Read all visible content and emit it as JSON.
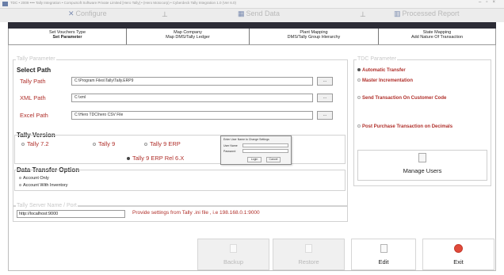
{
  "window": {
    "title": "TDC • 2009 •••• Tally Integration • CompuSoft Software Private Limited [Hero Tally] • (Hero Motocorp) • Cyberdeck Tally Integration 1.0 (Ver 6.0)"
  },
  "menubar": {
    "configure": "Configure",
    "send_data": "Send Data",
    "processed_report": "Processed Report"
  },
  "tabs": [
    {
      "line1": "Set Vouchers Type",
      "line2": "Set Parameter"
    },
    {
      "line1": "Map Company",
      "line2": "Map DMS/Tally Ledger"
    },
    {
      "line1": "Plant Mapping",
      "line2": "DMS/Tally Group Hierarchy"
    },
    {
      "line1": "State Mapping",
      "line2": "Add Nature Of Transaction"
    }
  ],
  "tally_parameter": {
    "legend": "Tally Parameter",
    "select_path_title": "Select Path",
    "tally_path_label": "Tally Path",
    "tally_path_value": "C:\\Program Files\\Tally\\Tally.ERP9",
    "xml_path_label": "XML Path",
    "xml_path_value": "C:\\xml",
    "excel_path_label": "Excel Path",
    "excel_path_value": "C:\\Hero TDC\\hero CSV File",
    "browse_label": "...",
    "version_title": "Tally Version",
    "versions": [
      "Tally 7.2",
      "Tally 9",
      "Tally 9 ERP",
      "Tally 9 ERP Rel 6.X"
    ],
    "transfer_title": "Data Transfer  Option",
    "transfer_options": [
      "Account Only",
      "Account With Inventory"
    ],
    "server_legend": "Tally Server Name / Port",
    "server_value": "http://localhost:9000",
    "server_hint": "Provide settings from Tally .ini file , i.e 198.168.0.1:9000"
  },
  "tdc_parameter": {
    "legend": "TDC Parameter",
    "options": [
      "Automatic Transfer",
      "Master Incrementation",
      "Send Transaction On Customer Code",
      "Post Purchase Transaction on Decimals"
    ],
    "manage_users": "Manage Users"
  },
  "dialog": {
    "title": "Enter User Name to Change Settings",
    "user_label": "User Name",
    "password_label": "Password",
    "login": "Login",
    "cancel": "Cancel"
  },
  "bottom_buttons": {
    "backup": "Backup",
    "restore": "Restore",
    "edit": "Edit",
    "exit": "Exit"
  }
}
